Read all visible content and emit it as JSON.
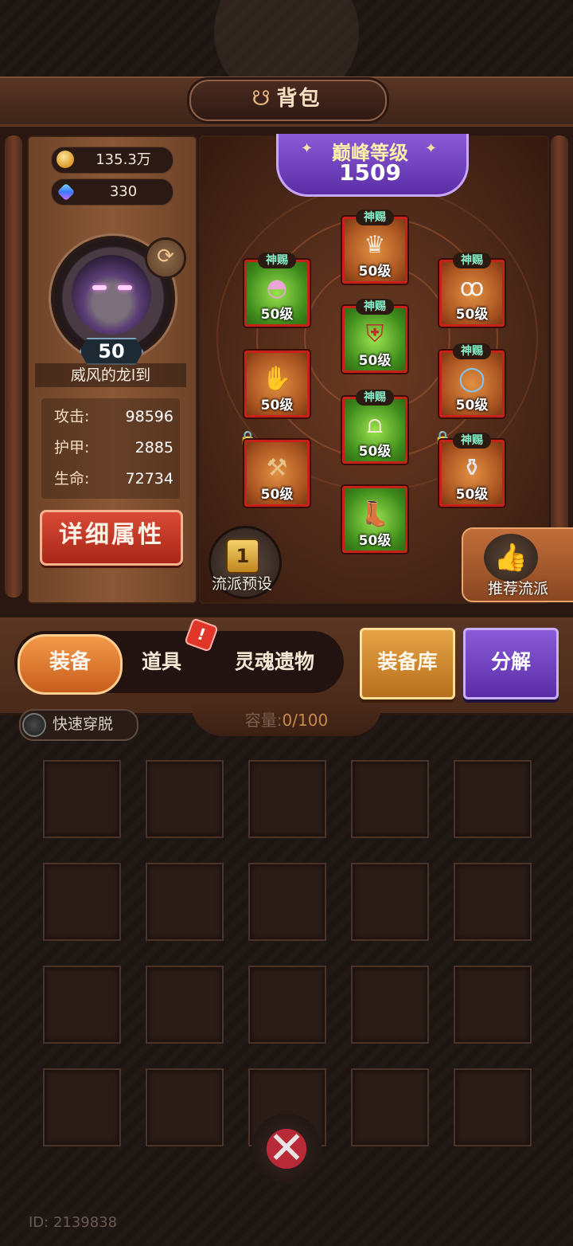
{
  "header": {
    "title": "背包",
    "icon": "bag-icon"
  },
  "currency": [
    {
      "icon": "coin-icon",
      "value": "135.3万"
    },
    {
      "icon": "gem-icon",
      "value": "330"
    }
  ],
  "player": {
    "level": "50",
    "name": "威风的龙l到",
    "stats": [
      {
        "key": "攻击:",
        "value": "98596"
      },
      {
        "key": "护甲:",
        "value": "2885"
      },
      {
        "key": "生命:",
        "value": "72734"
      }
    ],
    "detail_button": "详细属性"
  },
  "peak": {
    "title": "巅峰等级",
    "value": "1509"
  },
  "gear_slots": [
    {
      "name": "helmet",
      "level": "50级",
      "tag": "神赐",
      "color": "orange",
      "locked": false
    },
    {
      "name": "shoulder",
      "level": "50级",
      "tag": "神赐",
      "color": "green",
      "locked": false
    },
    {
      "name": "necklace",
      "level": "50级",
      "tag": "神赐",
      "color": "orange",
      "locked": false
    },
    {
      "name": "chest",
      "level": "50级",
      "tag": "神赐",
      "color": "green",
      "locked": false
    },
    {
      "name": "gloves",
      "level": "50级",
      "tag": "",
      "color": "orange",
      "locked": false
    },
    {
      "name": "ring",
      "level": "50级",
      "tag": "神赐",
      "color": "orange",
      "locked": false
    },
    {
      "name": "pants",
      "level": "50级",
      "tag": "神赐",
      "color": "green",
      "locked": false
    },
    {
      "name": "weapon",
      "level": "50级",
      "tag": "",
      "color": "orange",
      "locked": true
    },
    {
      "name": "pouch",
      "level": "50级",
      "tag": "神赐",
      "color": "orange",
      "locked": true
    },
    {
      "name": "boots",
      "level": "50级",
      "tag": "",
      "color": "green",
      "locked": false
    }
  ],
  "preset_button": "流派预设",
  "recommend_button": "推荐流派",
  "tabs": [
    {
      "label": "装备",
      "active": true
    },
    {
      "label": "道具",
      "active": false,
      "badge": "!"
    },
    {
      "label": "灵魂遗物",
      "active": false
    }
  ],
  "actions": {
    "storage": "装备库",
    "decompose": "分解"
  },
  "quick_toggle": "快速穿脱",
  "capacity": {
    "label": "容量:",
    "value": "0/100"
  },
  "player_id": "ID: 2139838",
  "colors": {
    "accent_orange": "#e48a3c",
    "accent_purple": "#6b3fc0",
    "slot_border": "#c8211a"
  }
}
